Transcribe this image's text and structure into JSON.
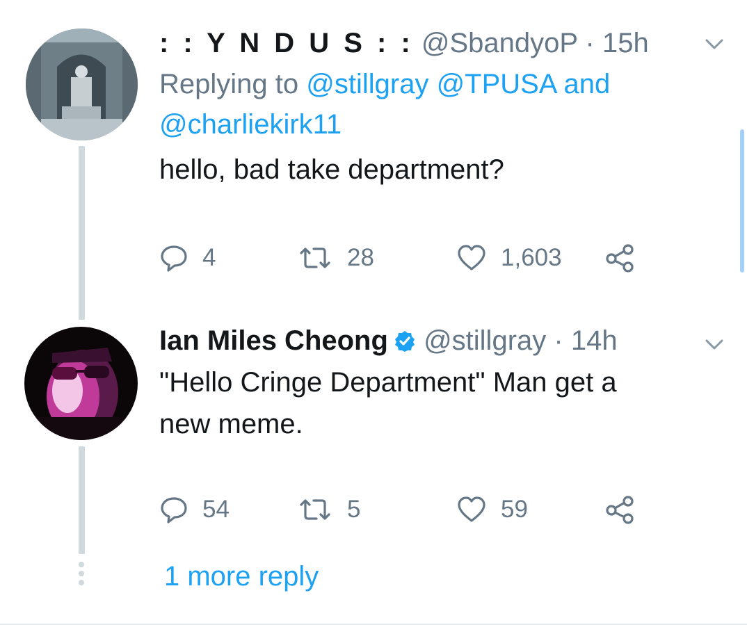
{
  "tweets": [
    {
      "display_name": ": : Y N D U S : :",
      "handle": "@SbandyoP",
      "separator": "·",
      "time": "15h",
      "replying_prefix": "Replying to",
      "replying_mentions": [
        "@stillgray",
        "@TPUSA"
      ],
      "replying_and": "and",
      "replying_last": "@charliekirk11",
      "text": "hello, bad take department?",
      "stats": {
        "replies": "4",
        "retweets": "28",
        "likes": "1,603"
      }
    },
    {
      "display_name": "Ian Miles Cheong",
      "verified": true,
      "handle": "@stillgray",
      "separator": "·",
      "time": "14h",
      "text_line1": "\"Hello Cringe Department\" Man get a",
      "text_line2": "new meme.",
      "stats": {
        "replies": "54",
        "retweets": "5",
        "likes": "59"
      }
    }
  ],
  "more_replies": "1 more reply",
  "colors": {
    "accent": "#1da1f2",
    "muted": "#657786",
    "text": "#14171a",
    "thread_line": "#cfd9de"
  },
  "icons": [
    "chevron-down-icon",
    "reply-icon",
    "retweet-icon",
    "like-icon",
    "share-icon",
    "verified-badge-icon"
  ]
}
